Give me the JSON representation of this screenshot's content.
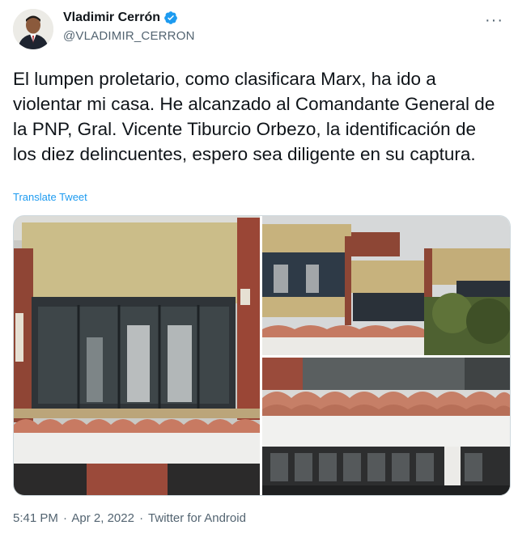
{
  "author": {
    "name": "Vladimir Cerrón",
    "handle": "@VLADIMIR_CERRON",
    "verified": true,
    "avatar_icon": "profile-photo"
  },
  "tweet": {
    "text": "El lumpen proletario, como clasificara Marx, ha ido a violentar mi casa. He alcanzado al Comandante General de la PNP, Gral. Vicente Tiburcio Orbezo, la identificación de los diez delincuentes, espero sea diligente en su captura.",
    "translate_label": "Translate Tweet"
  },
  "media": {
    "photos": [
      {
        "description_icon": "house-facade-photo"
      },
      {
        "description_icon": "house-exterior-photo"
      },
      {
        "description_icon": "roof-tiles-photo"
      }
    ]
  },
  "meta": {
    "time": "5:41 PM",
    "separator": "·",
    "date": "Apr 2, 2022",
    "source": "Twitter for Android"
  },
  "colors": {
    "link": "#1d9bf0",
    "secondary_text": "#536471",
    "verified_badge": "#1d9bf0"
  },
  "icons": {
    "more": "more-options-icon",
    "verified": "verified-badge-icon"
  }
}
